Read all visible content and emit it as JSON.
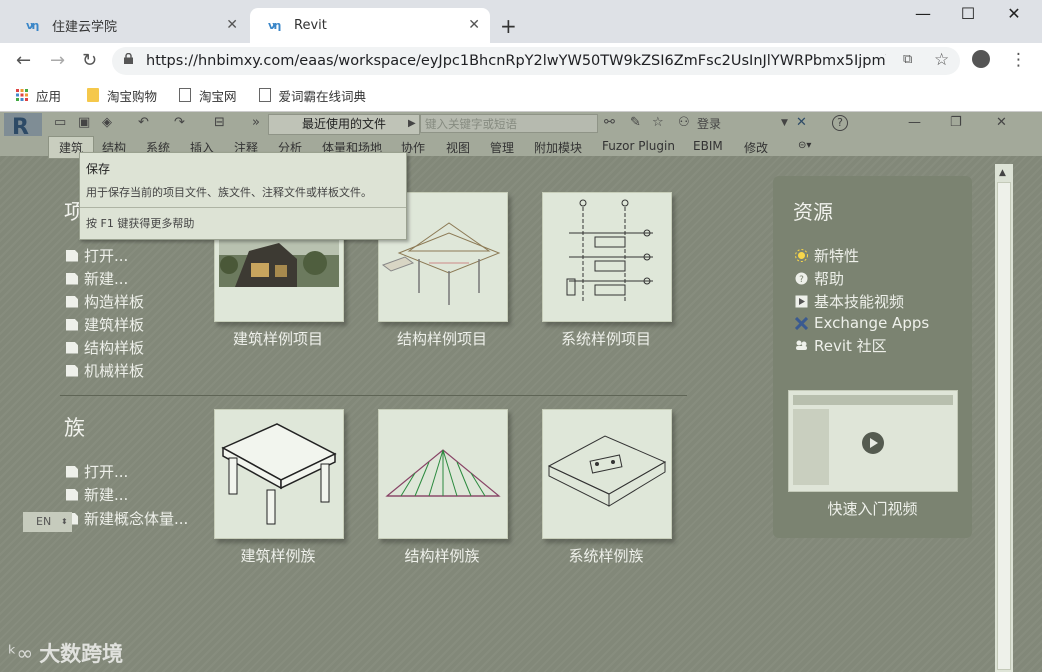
{
  "browser": {
    "tabs": [
      {
        "title": "住建云学院",
        "active": false
      },
      {
        "title": "Revit",
        "active": true
      }
    ],
    "new_tab_symbol": "+",
    "url": "https://hnbimxy.com/eaas/workspace/eyJpc1BhcnRpY2lwYW50TW9kZSI6ZmFsc2UsInJlYWRPbmx5IjpmYWxz...",
    "bookmarks": [
      {
        "label": "应用",
        "icon": "apps-grid-icon"
      },
      {
        "label": "淘宝购物",
        "icon": "folder-icon"
      },
      {
        "label": "淘宝网",
        "icon": "page-icon"
      },
      {
        "label": "爱词霸在线词典",
        "icon": "page-icon"
      }
    ]
  },
  "revit": {
    "recent_files": "最近使用的文件",
    "search_placeholder": "键入关键字或短语",
    "login": "登录",
    "help_symbol": "?",
    "ribbon_tabs": [
      "建筑",
      "结构",
      "系统",
      "插入",
      "注释",
      "分析",
      "体量和场地",
      "协作",
      "视图",
      "管理",
      "附加模块",
      "Fuzor Plugin",
      "EBIM",
      "修改"
    ],
    "tooltip": {
      "title": "保存",
      "description": "用于保存当前的项目文件、族文件、注释文件或样板文件。",
      "help": "按 F1 键获得更多帮助"
    },
    "projects": {
      "heading": "项",
      "links": [
        "打开...",
        "新建...",
        "构造样板",
        "建筑样板",
        "结构样板",
        "机械样板"
      ],
      "cards": [
        "建筑样例项目",
        "结构样例项目",
        "系统样例项目"
      ]
    },
    "families": {
      "heading": "族",
      "links": [
        "打开...",
        "新建...",
        "新建概念体量..."
      ],
      "cards": [
        "建筑样例族",
        "结构样例族",
        "系统样例族"
      ]
    },
    "resources": {
      "heading": "资源",
      "links": [
        {
          "label": "新特性",
          "icon": "sun-icon"
        },
        {
          "label": "帮助",
          "icon": "help-icon"
        },
        {
          "label": "基本技能视频",
          "icon": "play-icon"
        },
        {
          "label": "Exchange Apps",
          "icon": "exchange-icon"
        },
        {
          "label": "Revit 社区",
          "icon": "community-icon"
        }
      ],
      "video_label": "快速入门视频"
    },
    "lang": "EN"
  },
  "watermark": "大数跨境"
}
